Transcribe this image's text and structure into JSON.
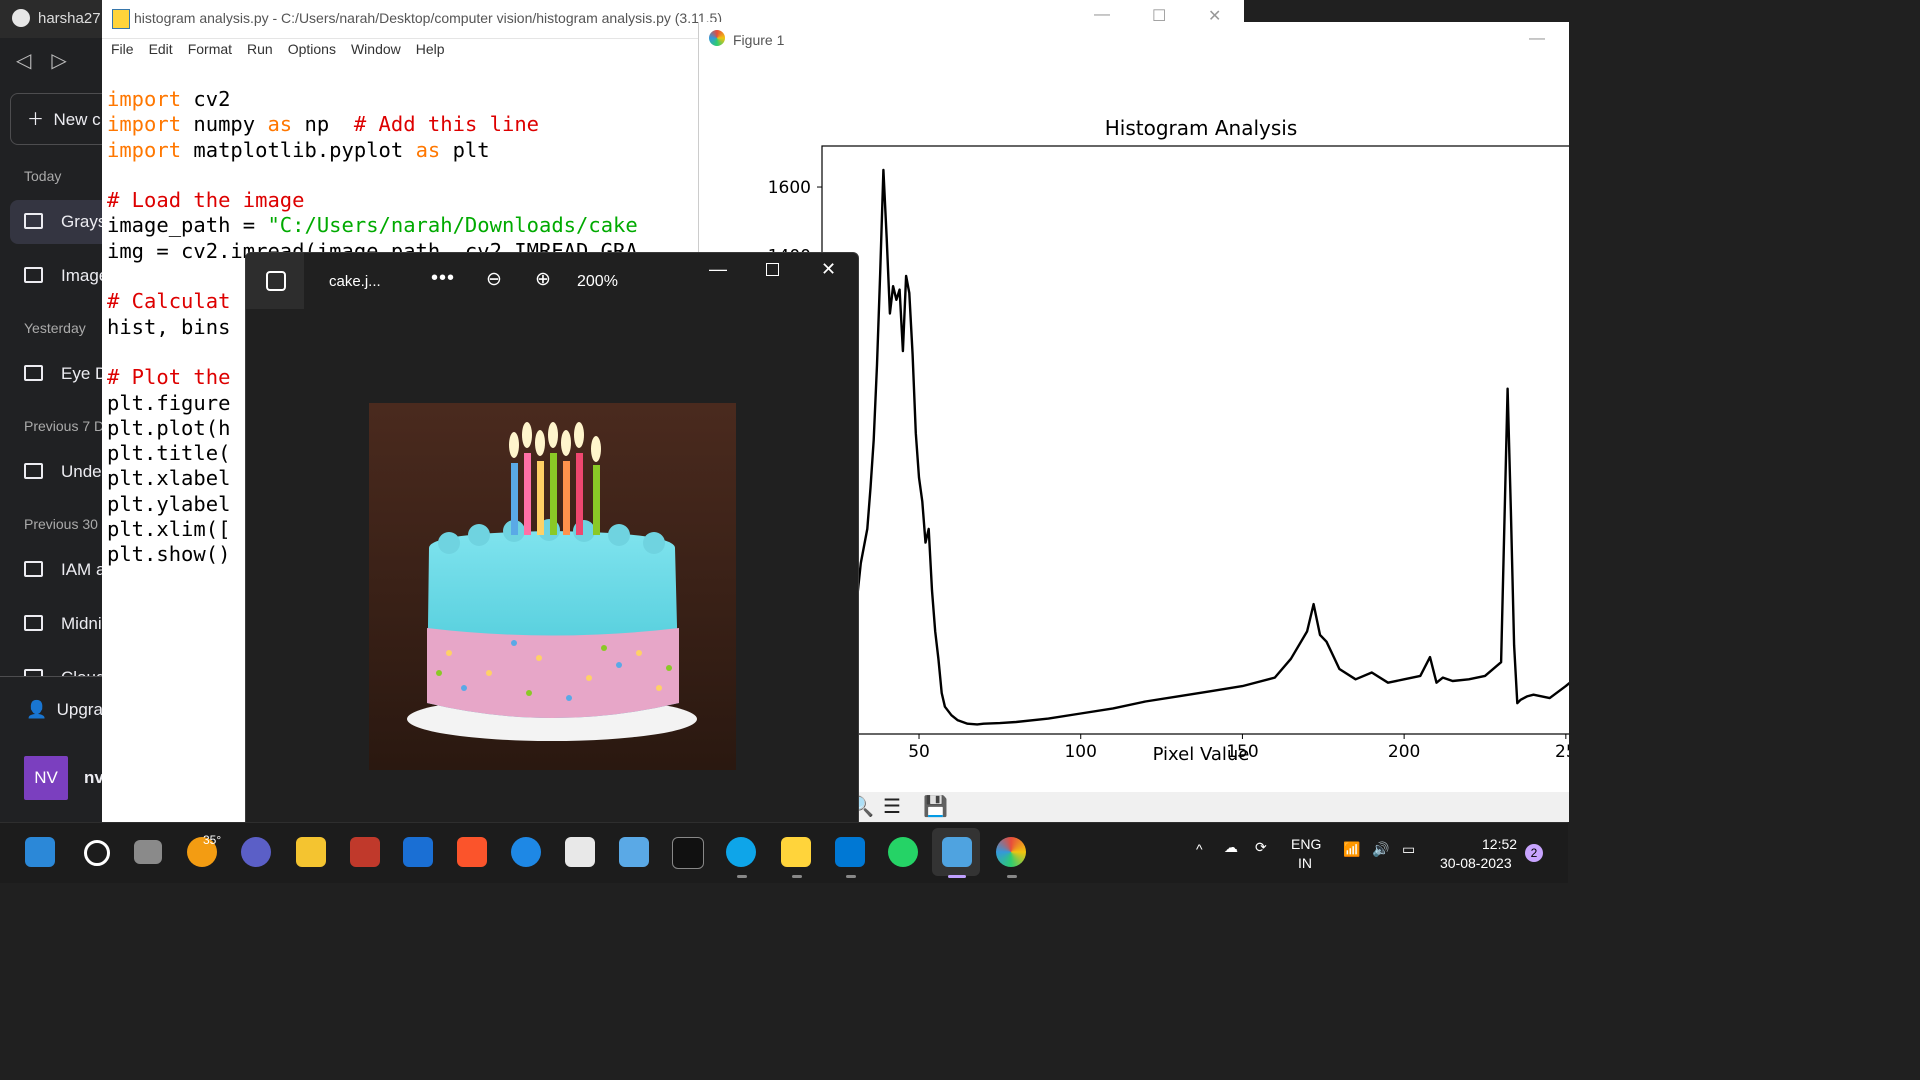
{
  "sidebar": {
    "github_user": "harsha27",
    "new_chat": "New c",
    "sections": {
      "today": "Today",
      "yesterday": "Yesterday",
      "prev7": "Previous 7 D",
      "prev30": "Previous 30"
    },
    "items": [
      "Grays",
      "Image",
      "Eye D",
      "Unde",
      "IAM a",
      "Midni",
      "Cloud"
    ],
    "upgrade": "Upgra",
    "avatar_initials": "NV",
    "user_name": "nv"
  },
  "idle": {
    "title": "histogram analysis.py - C:/Users/narah/Desktop/computer vision/histogram analysis.py (3.11.5)",
    "menu": [
      "File",
      "Edit",
      "Format",
      "Run",
      "Options",
      "Window",
      "Help"
    ],
    "code": {
      "l1_kw": "import",
      "l1_rest": " cv2",
      "l2_kw": "import",
      "l2_mid": " numpy ",
      "l2_kw2": "as",
      "l2_rest": " np  ",
      "l2_cm": "# Add this line",
      "l3_kw": "import",
      "l3_mid": " matplotlib.pyplot ",
      "l3_kw2": "as",
      "l3_rest": " plt",
      "l5_cm": "# Load the image",
      "l6_a": "image_path = ",
      "l6_st": "\"C:/Users/narah/Downloads/cake",
      "l7": "img = cv2.imread(image_path, cv2.IMREAD_GRA",
      "l9_cm": "# Calculat",
      "l10": "hist, bins",
      "l12_cm": "# Plot the",
      "l13": "plt.figure",
      "l14": "plt.plot(h",
      "l15": "plt.title(",
      "l16": "plt.xlabel",
      "l17": "plt.ylabel",
      "l18": "plt.xlim([",
      "l19": "plt.show()"
    }
  },
  "figure": {
    "window_title": "Figure 1"
  },
  "chart_data": {
    "type": "line",
    "title": "Histogram Analysis",
    "xlabel": "Pixel Value",
    "ylabel": "",
    "x_ticks": [
      "50",
      "100",
      "150",
      "200",
      "25"
    ],
    "y_ticks": [
      "1600",
      "1400"
    ],
    "xlim": [
      20,
      255
    ],
    "ylim": [
      0,
      1720
    ],
    "color": "#000000",
    "x": [
      20,
      25,
      28,
      30,
      32,
      34,
      35,
      36,
      37,
      38,
      39,
      40,
      41,
      42,
      43,
      44,
      45,
      46,
      47,
      48,
      49,
      50,
      51,
      52,
      53,
      54,
      55,
      56,
      57,
      58,
      60,
      62,
      65,
      68,
      70,
      75,
      80,
      90,
      100,
      110,
      120,
      130,
      140,
      150,
      160,
      165,
      170,
      172,
      174,
      176,
      178,
      180,
      185,
      190,
      195,
      200,
      205,
      208,
      210,
      212,
      215,
      220,
      225,
      230,
      232,
      233,
      234,
      235,
      236,
      238,
      240,
      245,
      250,
      255
    ],
    "y": [
      150,
      160,
      210,
      320,
      500,
      600,
      720,
      860,
      1080,
      1350,
      1650,
      1450,
      1230,
      1310,
      1270,
      1300,
      1120,
      1340,
      1290,
      1110,
      880,
      750,
      680,
      560,
      600,
      420,
      300,
      220,
      120,
      80,
      55,
      40,
      30,
      28,
      30,
      32,
      35,
      45,
      60,
      75,
      95,
      110,
      125,
      140,
      165,
      220,
      300,
      380,
      290,
      270,
      230,
      190,
      160,
      180,
      150,
      160,
      170,
      225,
      150,
      165,
      155,
      160,
      170,
      210,
      1010,
      650,
      260,
      90,
      100,
      110,
      115,
      105,
      140,
      180
    ]
  },
  "photos": {
    "filename": "cake.j...",
    "zoom": "200%"
  },
  "taskbar": {
    "weather": "35°",
    "lang1": "ENG",
    "lang2": "IN",
    "time": "12:52",
    "date": "30-08-2023",
    "notifications": "2"
  }
}
